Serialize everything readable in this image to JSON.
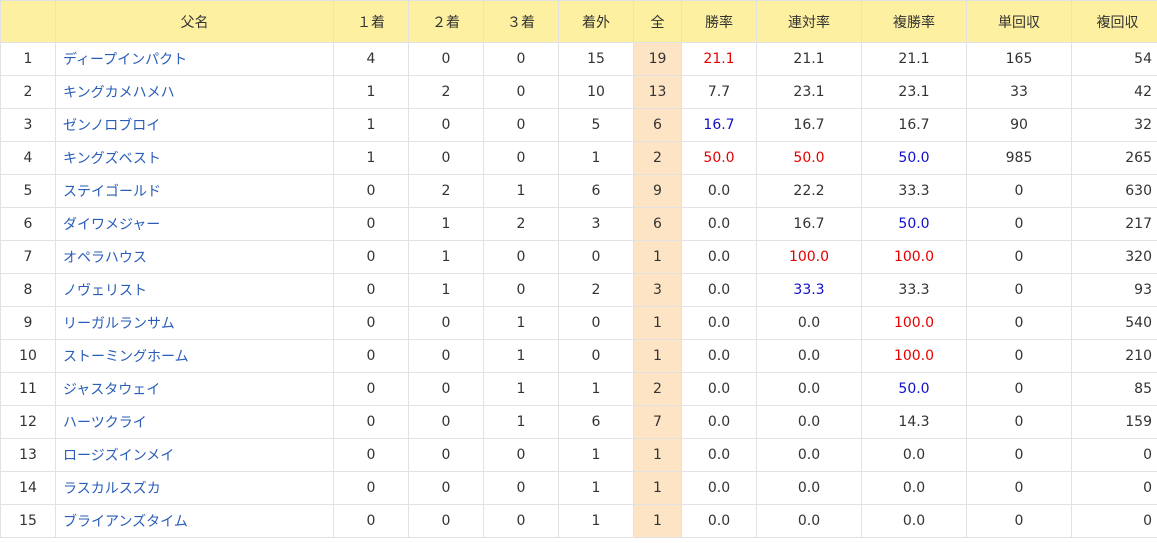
{
  "headers": [
    "",
    "父名",
    "１着",
    "２着",
    "３着",
    "着外",
    "全",
    "勝率",
    "連対率",
    "複勝率",
    "単回収",
    "複回収"
  ],
  "colors": {
    "header_bg": "#fdf0a0",
    "total_bg": "#fde4c4",
    "link": "#2a5db8",
    "red": "#e60000",
    "blue": "#1010cc"
  },
  "rows": [
    {
      "rank": "1",
      "name": "ディープインパクト",
      "w1": "4",
      "w2": "0",
      "w3": "0",
      "out": "15",
      "total": "19",
      "win": "21.1",
      "win_c": "red",
      "ren": "21.1",
      "ren_c": "",
      "fuku": "21.1",
      "fuku_c": "",
      "tan": "165",
      "fkr": "54"
    },
    {
      "rank": "2",
      "name": "キングカメハメハ",
      "w1": "1",
      "w2": "2",
      "w3": "0",
      "out": "10",
      "total": "13",
      "win": "7.7",
      "win_c": "",
      "ren": "23.1",
      "ren_c": "",
      "fuku": "23.1",
      "fuku_c": "",
      "tan": "33",
      "fkr": "42"
    },
    {
      "rank": "3",
      "name": "ゼンノロブロイ",
      "w1": "1",
      "w2": "0",
      "w3": "0",
      "out": "5",
      "total": "6",
      "win": "16.7",
      "win_c": "blue",
      "ren": "16.7",
      "ren_c": "",
      "fuku": "16.7",
      "fuku_c": "",
      "tan": "90",
      "fkr": "32"
    },
    {
      "rank": "4",
      "name": "キングズベスト",
      "w1": "1",
      "w2": "0",
      "w3": "0",
      "out": "1",
      "total": "2",
      "win": "50.0",
      "win_c": "red",
      "ren": "50.0",
      "ren_c": "red",
      "fuku": "50.0",
      "fuku_c": "blue",
      "tan": "985",
      "fkr": "265"
    },
    {
      "rank": "5",
      "name": "ステイゴールド",
      "w1": "0",
      "w2": "2",
      "w3": "1",
      "out": "6",
      "total": "9",
      "win": "0.0",
      "win_c": "",
      "ren": "22.2",
      "ren_c": "",
      "fuku": "33.3",
      "fuku_c": "",
      "tan": "0",
      "fkr": "630"
    },
    {
      "rank": "6",
      "name": "ダイワメジャー",
      "w1": "0",
      "w2": "1",
      "w3": "2",
      "out": "3",
      "total": "6",
      "win": "0.0",
      "win_c": "",
      "ren": "16.7",
      "ren_c": "",
      "fuku": "50.0",
      "fuku_c": "blue",
      "tan": "0",
      "fkr": "217"
    },
    {
      "rank": "7",
      "name": "オペラハウス",
      "w1": "0",
      "w2": "1",
      "w3": "0",
      "out": "0",
      "total": "1",
      "win": "0.0",
      "win_c": "",
      "ren": "100.0",
      "ren_c": "red",
      "fuku": "100.0",
      "fuku_c": "red",
      "tan": "0",
      "fkr": "320"
    },
    {
      "rank": "8",
      "name": "ノヴェリスト",
      "w1": "0",
      "w2": "1",
      "w3": "0",
      "out": "2",
      "total": "3",
      "win": "0.0",
      "win_c": "",
      "ren": "33.3",
      "ren_c": "blue",
      "fuku": "33.3",
      "fuku_c": "",
      "tan": "0",
      "fkr": "93"
    },
    {
      "rank": "9",
      "name": "リーガルランサム",
      "w1": "0",
      "w2": "0",
      "w3": "1",
      "out": "0",
      "total": "1",
      "win": "0.0",
      "win_c": "",
      "ren": "0.0",
      "ren_c": "",
      "fuku": "100.0",
      "fuku_c": "red",
      "tan": "0",
      "fkr": "540"
    },
    {
      "rank": "10",
      "name": "ストーミングホーム",
      "w1": "0",
      "w2": "0",
      "w3": "1",
      "out": "0",
      "total": "1",
      "win": "0.0",
      "win_c": "",
      "ren": "0.0",
      "ren_c": "",
      "fuku": "100.0",
      "fuku_c": "red",
      "tan": "0",
      "fkr": "210"
    },
    {
      "rank": "11",
      "name": "ジャスタウェイ",
      "w1": "0",
      "w2": "0",
      "w3": "1",
      "out": "1",
      "total": "2",
      "win": "0.0",
      "win_c": "",
      "ren": "0.0",
      "ren_c": "",
      "fuku": "50.0",
      "fuku_c": "blue",
      "tan": "0",
      "fkr": "85"
    },
    {
      "rank": "12",
      "name": "ハーツクライ",
      "w1": "0",
      "w2": "0",
      "w3": "1",
      "out": "6",
      "total": "7",
      "win": "0.0",
      "win_c": "",
      "ren": "0.0",
      "ren_c": "",
      "fuku": "14.3",
      "fuku_c": "",
      "tan": "0",
      "fkr": "159"
    },
    {
      "rank": "13",
      "name": "ロージズインメイ",
      "w1": "0",
      "w2": "0",
      "w3": "0",
      "out": "1",
      "total": "1",
      "win": "0.0",
      "win_c": "",
      "ren": "0.0",
      "ren_c": "",
      "fuku": "0.0",
      "fuku_c": "",
      "tan": "0",
      "fkr": "0"
    },
    {
      "rank": "14",
      "name": "ラスカルスズカ",
      "w1": "0",
      "w2": "0",
      "w3": "0",
      "out": "1",
      "total": "1",
      "win": "0.0",
      "win_c": "",
      "ren": "0.0",
      "ren_c": "",
      "fuku": "0.0",
      "fuku_c": "",
      "tan": "0",
      "fkr": "0"
    },
    {
      "rank": "15",
      "name": "ブライアンズタイム",
      "w1": "0",
      "w2": "0",
      "w3": "0",
      "out": "1",
      "total": "1",
      "win": "0.0",
      "win_c": "",
      "ren": "0.0",
      "ren_c": "",
      "fuku": "0.0",
      "fuku_c": "",
      "tan": "0",
      "fkr": "0"
    }
  ]
}
